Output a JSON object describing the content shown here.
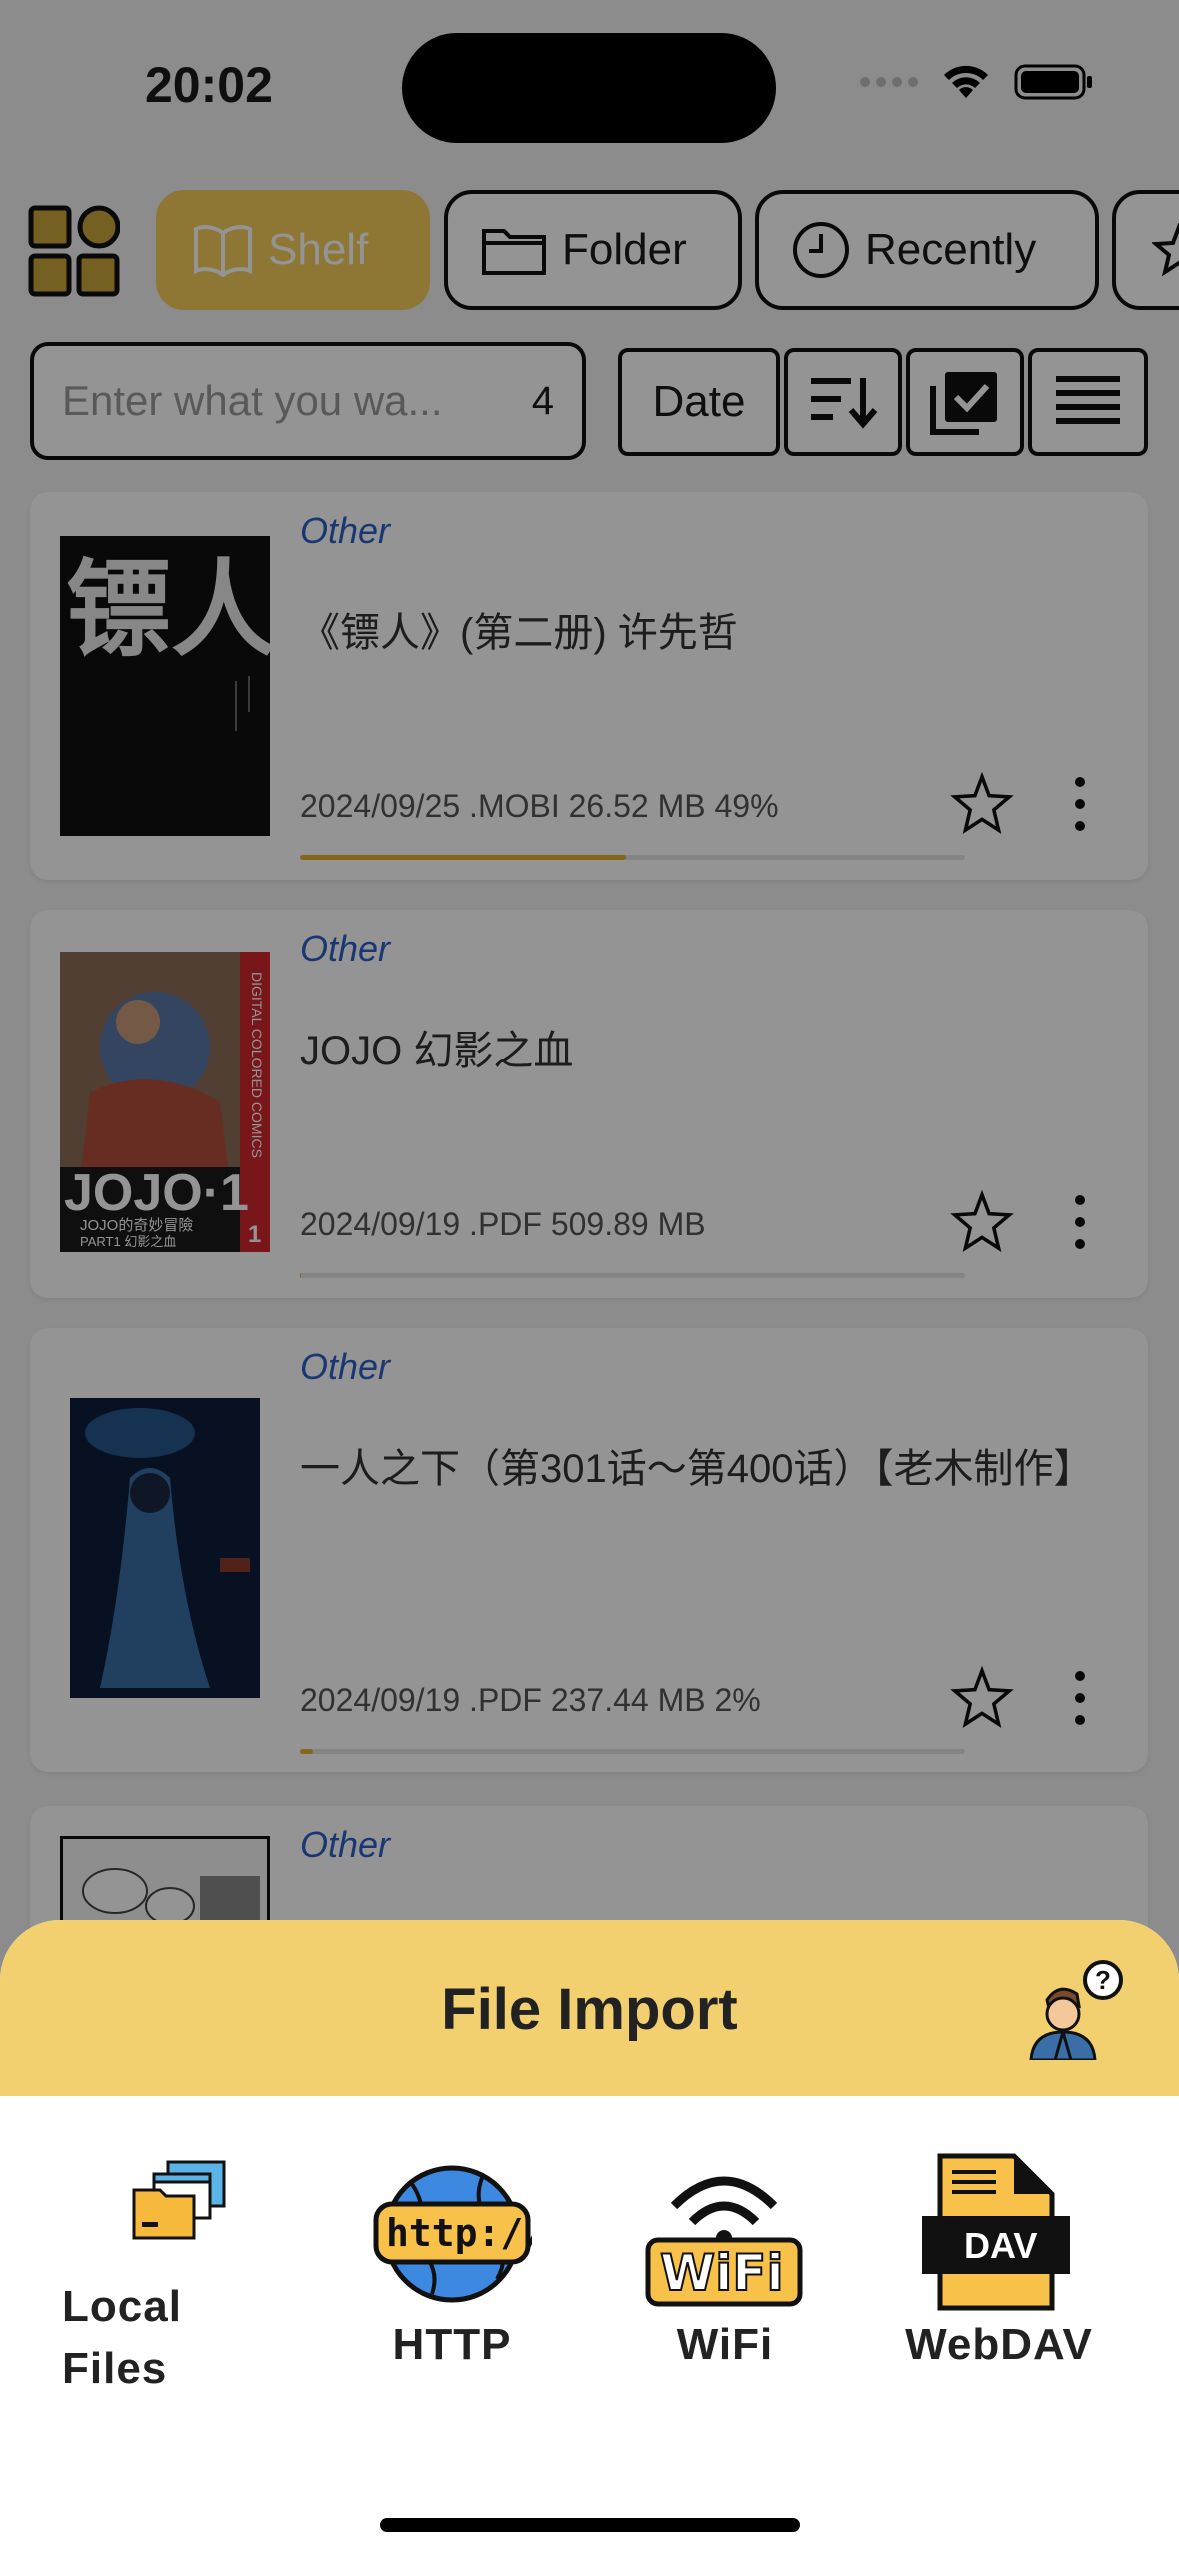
{
  "status": {
    "time": "20:02"
  },
  "tabs": [
    {
      "label": "Shelf",
      "icon": "book-icon"
    },
    {
      "label": "Folder",
      "icon": "folder-icon"
    },
    {
      "label": "Recently",
      "icon": "clock-icon"
    }
  ],
  "search": {
    "placeholder": "Enter what you wa...",
    "count": "4"
  },
  "sort": {
    "label": "Date"
  },
  "books": [
    {
      "category": "Other",
      "title": "《镖人》(第二册) 许先哲",
      "meta": "2024/09/25 .MOBI 26.52 MB 49%",
      "progress": 0.49
    },
    {
      "category": "Other",
      "title": "JOJO 幻影之血",
      "meta": "2024/09/19 .PDF 509.89 MB",
      "progress": 0.0
    },
    {
      "category": "Other",
      "title": "一人之下（第301话～第400话）【老木制作】",
      "meta": "2024/09/19 .PDF 237.44 MB 2%",
      "progress": 0.02
    },
    {
      "category": "Other"
    }
  ],
  "covers": {
    "book1": "镖人",
    "book2_title": "JOJO·1",
    "book2_sub": "JOJO的奇妙冒險",
    "book2_sub2": "PART1 幻影之血",
    "book2_side": "DIGITAL COLORED COMICS",
    "book2_num": "1"
  },
  "sheet": {
    "title": "File Import",
    "options": [
      {
        "label": "Local\nFiles",
        "icon": "local-files-icon"
      },
      {
        "label": "HTTP",
        "icon": "http-globe-icon",
        "badge": "http://"
      },
      {
        "label": "WiFi",
        "icon": "wifi-sign-icon",
        "badge": "WiFi"
      },
      {
        "label": "WebDAV",
        "icon": "dav-file-icon",
        "badge": "DAV"
      }
    ]
  },
  "colors": {
    "accent": "#f5cc5b",
    "sheet_header": "#f2d06f",
    "category": "#2b61c7",
    "progress": "#e3b22d"
  }
}
